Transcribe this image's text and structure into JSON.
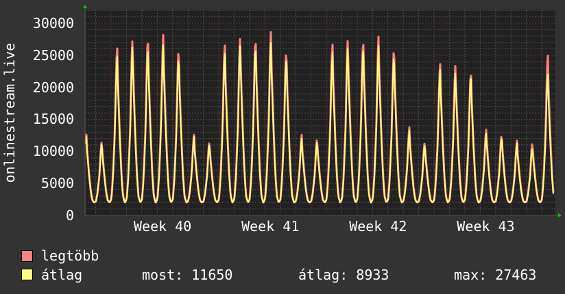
{
  "chart_data": {
    "type": "line",
    "ylabel": "onlinestream.live",
    "ylim": [
      0,
      32000
    ],
    "yticks": [
      0,
      5000,
      10000,
      15000,
      20000,
      25000,
      30000
    ],
    "ytick_labels": [
      "0",
      "5000",
      "10000",
      "15000",
      "20000",
      "25000",
      "30000"
    ],
    "xtick_labels": [
      "Week 40",
      "Week 41",
      "Week 42",
      "Week 43"
    ],
    "grid": true,
    "trough": 2000,
    "series": [
      {
        "name": "legtöbb",
        "color": "#ff8080",
        "daily_peaks": [
          12600,
          11800,
          26900,
          28000,
          28600,
          28600,
          26800,
          12600,
          11700,
          27300,
          28400,
          28500,
          29100,
          26600,
          12600,
          12200,
          27400,
          28100,
          28300,
          28400,
          27000,
          13800,
          11700,
          24200,
          24100,
          23100,
          13600,
          13000,
          11700,
          11600,
          25500
        ]
      },
      {
        "name": "átlag",
        "color": "#ffff80",
        "daily_peaks": [
          12300,
          11500,
          25600,
          27000,
          27200,
          27000,
          25600,
          12300,
          11400,
          26000,
          27300,
          27300,
          27400,
          25600,
          12000,
          11800,
          26100,
          26900,
          27200,
          26900,
          26000,
          13300,
          11300,
          23300,
          22900,
          22600,
          13000,
          12600,
          11300,
          10800,
          22500
        ]
      }
    ]
  },
  "legend": {
    "max_label": "legtöbb",
    "avg_label": "átlag",
    "now": "most: 11650",
    "avg": "átlag: 8933",
    "max": "max: 27463"
  },
  "colors": {
    "background": "#333333",
    "plot": "#222222",
    "max": "#ff8080",
    "avg": "#ffff80"
  }
}
